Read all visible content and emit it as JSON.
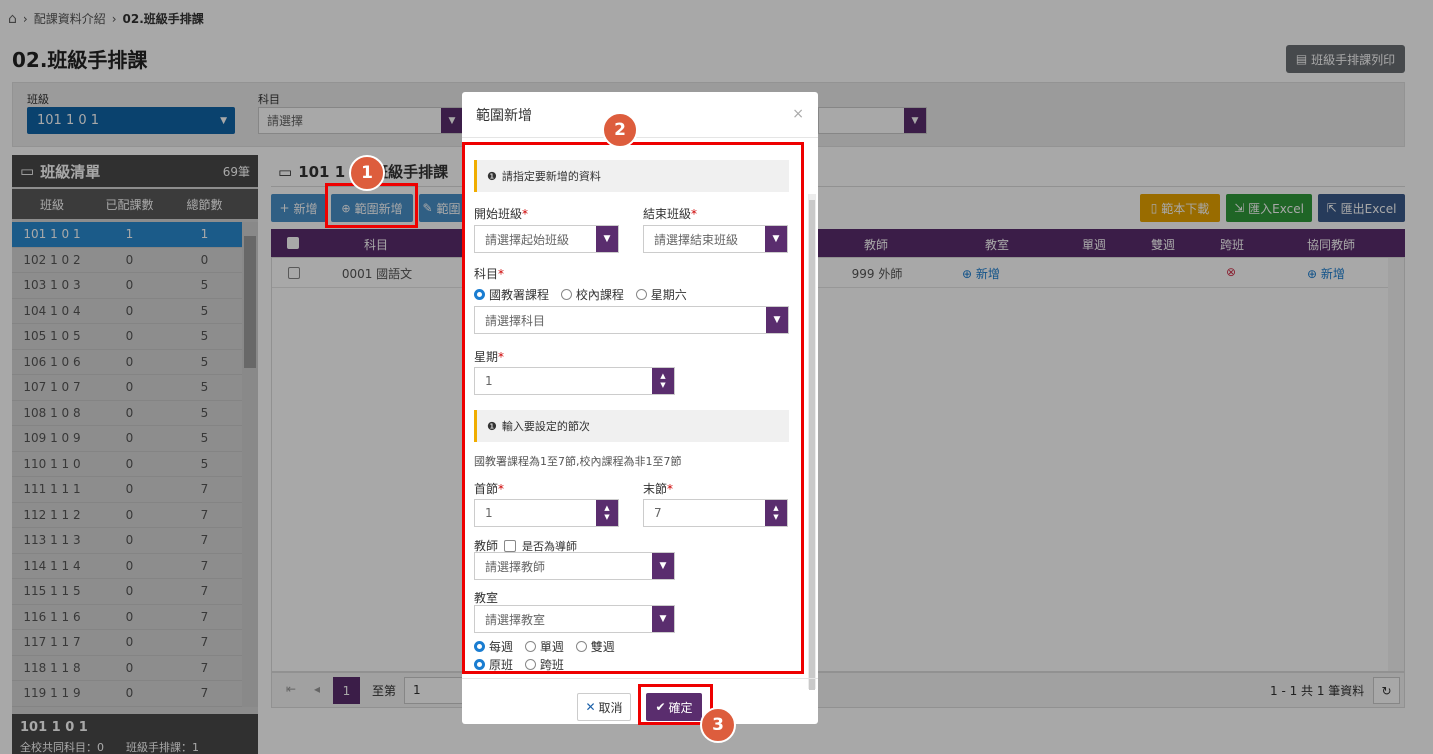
{
  "breadcrumb": {
    "home": "⌂",
    "sep": "›",
    "item1": "配課資料介紹",
    "item2": "02.班級手排課"
  },
  "page_title": "02.班級手排課",
  "print_button": "班級手排課列印",
  "filters": {
    "class_label": "班級",
    "class_value": "101 1 0 1",
    "subject_label": "科目",
    "subject_placeholder": "請選擇"
  },
  "sidebar": {
    "title": "班級清單",
    "count": "69筆",
    "columns": [
      "班級",
      "已配課數",
      "總節數"
    ],
    "rows": [
      [
        "101 1 0 1",
        "1",
        "1"
      ],
      [
        "102 1 0 2",
        "0",
        "0"
      ],
      [
        "103 1 0 3",
        "0",
        "5"
      ],
      [
        "104 1 0 4",
        "0",
        "5"
      ],
      [
        "105 1 0 5",
        "0",
        "5"
      ],
      [
        "106 1 0 6",
        "0",
        "5"
      ],
      [
        "107 1 0 7",
        "0",
        "5"
      ],
      [
        "108 1 0 8",
        "0",
        "5"
      ],
      [
        "109 1 0 9",
        "0",
        "5"
      ],
      [
        "110 1 1 0",
        "0",
        "5"
      ],
      [
        "111 1 1 1",
        "0",
        "7"
      ],
      [
        "112 1 1 2",
        "0",
        "7"
      ],
      [
        "113 1 1 3",
        "0",
        "7"
      ],
      [
        "114 1 1 4",
        "0",
        "7"
      ],
      [
        "115 1 1 5",
        "0",
        "7"
      ],
      [
        "116 1 1 6",
        "0",
        "7"
      ],
      [
        "117 1 1 7",
        "0",
        "7"
      ],
      [
        "118 1 1 8",
        "0",
        "7"
      ],
      [
        "119 1 1 9",
        "0",
        "7"
      ]
    ],
    "footer_title": "101 1 0 1",
    "footer_line": "全校共同科目：0　　班級手排課：1"
  },
  "main": {
    "title_prefix": "101 1",
    "title_suffix": "班級手排課",
    "add_button": "新增",
    "range_add_button": "範圍新增",
    "edit_button": "範圍",
    "template_download": "範本下載",
    "import_excel": "匯入Excel",
    "export_excel": "匯出Excel",
    "columns": {
      "subject": "科目",
      "teacher": "教師",
      "room": "教室",
      "single": "單週",
      "double": "雙週",
      "cross": "跨班",
      "co_teacher": "協同教師"
    },
    "row": {
      "subject": "0001 國語文",
      "teacher": "999 外師",
      "room_add": "新增",
      "co_add": "新增"
    },
    "pager_page": "1",
    "pager_goto": "至第",
    "pager_goto_value": "1",
    "pager_info": "1 - 1 共 1 筆資料"
  },
  "modal": {
    "title": "範圍新增",
    "section1": "請指定要新增的資料",
    "start_class_label": "開始班級",
    "start_class_placeholder": "請選擇起始班級",
    "end_class_label": "結束班級",
    "end_class_placeholder": "請選擇結束班級",
    "subject_label": "科目",
    "subject_radios": [
      "國教署課程",
      "校內課程",
      "星期六"
    ],
    "subject_placeholder": "請選擇科目",
    "weekday_label": "星期",
    "weekday_value": "1",
    "section2": "輸入要設定的節次",
    "hint": "國教署課程為1至7節,校內課程為非1至7節",
    "first_period_label": "首節",
    "first_period_value": "1",
    "last_period_label": "末節",
    "last_period_value": "7",
    "teacher_label": "教師",
    "homeroom_label": "是否為導師",
    "teacher_placeholder": "請選擇教師",
    "room_label": "教室",
    "room_placeholder": "請選擇教室",
    "week_radios": [
      "每週",
      "單週",
      "雙週"
    ],
    "class_radios": [
      "原班",
      "跨班"
    ],
    "cancel": "取消",
    "confirm": "確定"
  },
  "callouts": [
    "1",
    "2",
    "3"
  ],
  "colors": {
    "purple": "#5a2d6e",
    "blue": "#1065a8",
    "highlight": "#e00000",
    "callout": "#dd5d3d"
  }
}
